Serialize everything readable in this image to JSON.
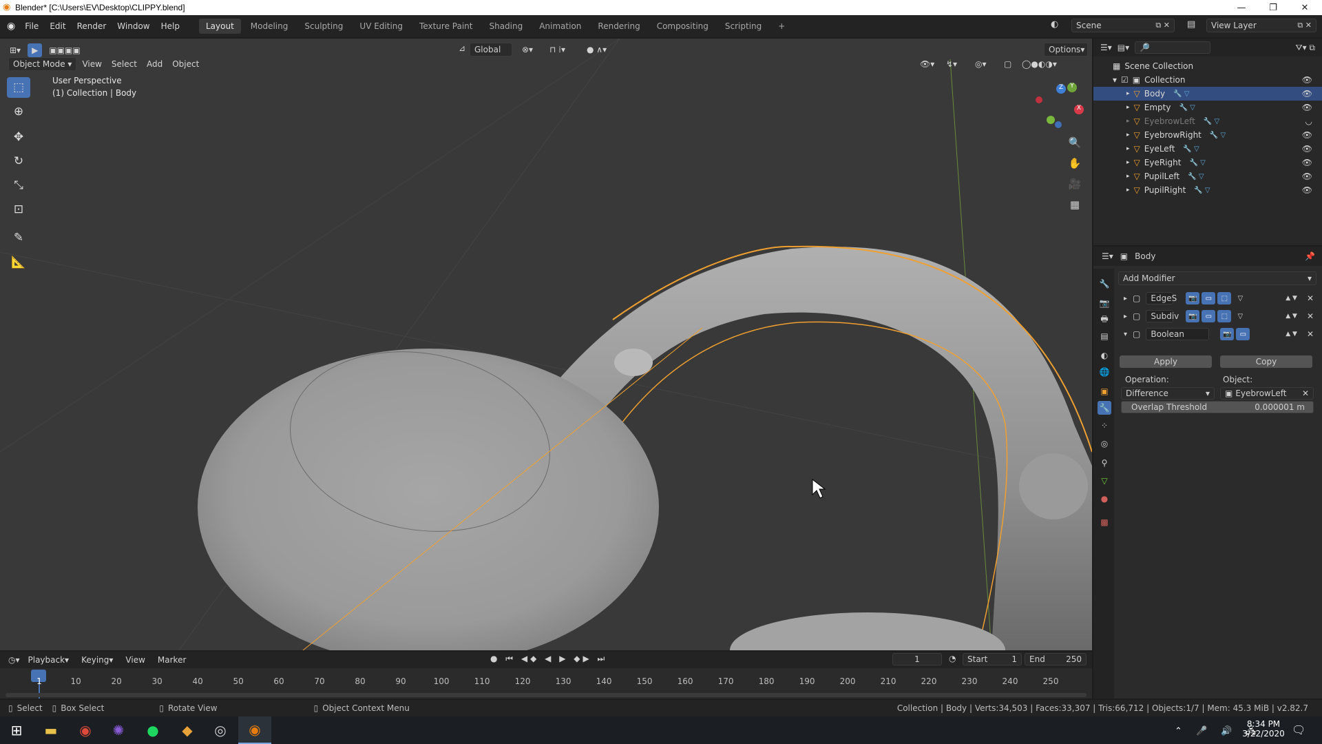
{
  "window": {
    "title": "Blender* [C:\\Users\\EV\\Desktop\\CLIPPY.blend]",
    "minimize": "—",
    "restore": "❐",
    "close": "✕"
  },
  "menu": {
    "file": "File",
    "edit": "Edit",
    "render": "Render",
    "window": "Window",
    "help": "Help"
  },
  "workspaces": [
    "Layout",
    "Modeling",
    "Sculpting",
    "UV Editing",
    "Texture Paint",
    "Shading",
    "Animation",
    "Rendering",
    "Compositing",
    "Scripting"
  ],
  "add_workspace": "+",
  "scene": {
    "name": "Scene",
    "view_layer": "View Layer"
  },
  "viewport": {
    "mode": "Object Mode",
    "menus": [
      "View",
      "Select",
      "Add",
      "Object"
    ],
    "orientation": "Global",
    "options": "Options",
    "overlay_line1": "User Perspective",
    "overlay_line2": "(1) Collection | Body",
    "gizmo": {
      "x": "X",
      "y": "Y",
      "z": "Z"
    }
  },
  "outliner": {
    "root": "Scene Collection",
    "collection": "Collection",
    "items": [
      {
        "name": "Body",
        "selected": true,
        "hidden": false
      },
      {
        "name": "Empty",
        "selected": false,
        "hidden": false
      },
      {
        "name": "EyebrowLeft",
        "selected": false,
        "hidden": true
      },
      {
        "name": "EyebrowRight",
        "selected": false,
        "hidden": false
      },
      {
        "name": "EyeLeft",
        "selected": false,
        "hidden": false
      },
      {
        "name": "EyeRight",
        "selected": false,
        "hidden": false
      },
      {
        "name": "PupilLeft",
        "selected": false,
        "hidden": false
      },
      {
        "name": "PupilRight",
        "selected": false,
        "hidden": false
      }
    ]
  },
  "properties": {
    "object_name": "Body",
    "add_modifier": "Add Modifier",
    "modifiers": [
      {
        "name": "EdgeS",
        "expanded": false
      },
      {
        "name": "Subdiv",
        "expanded": false
      },
      {
        "name": "Boolean",
        "expanded": true
      }
    ],
    "apply": "Apply",
    "copy": "Copy",
    "operation_label": "Operation:",
    "object_label": "Object:",
    "operation_value": "Difference",
    "object_value": "EyebrowLeft",
    "overlap_label": "Overlap Threshold",
    "overlap_value": "0.000001 m"
  },
  "timeline": {
    "menus": [
      "Playback",
      "Keying",
      "View",
      "Marker"
    ],
    "current_frame": "1",
    "start_label": "Start",
    "start": "1",
    "end_label": "End",
    "end": "250",
    "ticks": [
      "1",
      "10",
      "20",
      "30",
      "40",
      "50",
      "60",
      "70",
      "80",
      "90",
      "100",
      "110",
      "120",
      "130",
      "140",
      "150",
      "160",
      "170",
      "180",
      "190",
      "200",
      "210",
      "220",
      "230",
      "240",
      "250"
    ]
  },
  "status": {
    "select": "Select",
    "box_select": "Box Select",
    "rotate": "Rotate View",
    "context": "Object Context Menu",
    "info": "Collection | Body | Verts:34,503 | Faces:33,307 | Tris:66,712 | Objects:1/7 | Mem: 45.3 MiB | v2.82.7"
  },
  "taskbar": {
    "time": "8:34 PM",
    "date": "3/22/2020"
  },
  "colors": {
    "accent": "#4772b3",
    "selection_outline": "#f0a030",
    "viewport_bg": "#393939",
    "panel_bg": "#2b2b2b"
  }
}
